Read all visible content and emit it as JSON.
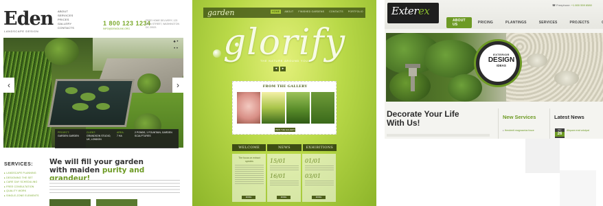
{
  "eden": {
    "logo": "Eden",
    "subtitle": "LANDSCAPE DESIGN",
    "nav": [
      "ABOUT",
      "SERVICES",
      "PRICES",
      "GALLERY",
      "CONTACTS"
    ],
    "phone": "1 800 123 1234",
    "email": "INFO@DEMOLINK.ORG",
    "address": "FREE HOME DELIVERY, 123 MAIN STREET, WASHINGTON DC 20021",
    "strip": [
      {
        "k": "PROJECT:",
        "v": "GARDEN GARDEN"
      },
      {
        "k": "CLIENT:",
        "v": "GRANDSON STUDIO, UK, LONDON"
      },
      {
        "k": "AREA:",
        "v": "7 HA"
      },
      {
        "k": "",
        "v": "2 PONDS, 1 FOUNTAIN, GARDEN SCULPTURES"
      }
    ],
    "services_title": "SERVICES:",
    "services": [
      "LANDSCAPE PLANNING",
      "DESIGNING THE SET",
      "CARE DAY SCHEDULING",
      "FREE CONSULTATION",
      "QUALITY WORK",
      "SINGLE-ZONE ELEMENTS"
    ],
    "headline_a": "We will fill your garden with maiden",
    "headline_b": "purity and grandeur!",
    "arrow_prev": "‹",
    "arrow_next": "›",
    "dots": "♠ • • •"
  },
  "glorify": {
    "logo": "garden",
    "nav": [
      "HOME",
      "ABOUT",
      "FINISHED GARDENS",
      "CONTACTS",
      "PORTFOLIO"
    ],
    "title": "glorify",
    "tagline": "THE NATURE AROUND YOU",
    "arrow_prev": "◂",
    "arrow_next": "▸",
    "gallery_title": "FROM THE GALLERY",
    "gallery_button": "VIEW THE GALLERY",
    "tabs": [
      "WELCOME",
      "NEWS",
      "EXHIBITIONS"
    ],
    "col1": "The focus on extract species",
    "col2_date1": "15/01",
    "col2_date2": "16/01",
    "col3_date1": "01/01",
    "col3_date2": "03/01",
    "more": "MORE"
  },
  "exterex": {
    "logo_a": "Exter",
    "logo_b": "ex",
    "phone_label": "Freephone:",
    "phone": "+1 800 559 6580",
    "nav": [
      "ABOUT US",
      "PRICING",
      "PLANTINGS",
      "SERVICES",
      "PROJECTS",
      "CONTACTS"
    ],
    "badge_a": "EXTERIOR",
    "badge_b": "DESIGN",
    "badge_c": "IDEAS",
    "deco": "Decorate Your Life With Us!",
    "new_services": "New Services",
    "ns_item": "Hendrerit magnaarius fusce",
    "latest_news": "Latest News",
    "news_month": "Dec",
    "news_day": "26",
    "news_text": "Aliquam erat volutpat"
  }
}
